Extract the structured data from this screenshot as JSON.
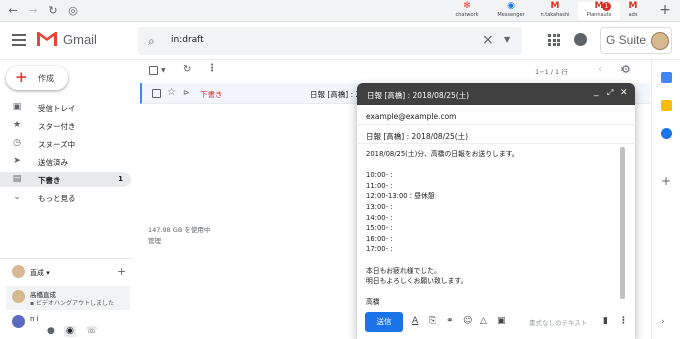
{
  "browser": {
    "extensions": [
      {
        "icon": "✻",
        "label": "chatwork",
        "color": "#e2473a"
      },
      {
        "icon": "◉",
        "label": "Messenger",
        "color": "#1877f2"
      },
      {
        "icon": "M",
        "label": "n.takahashi",
        "color": "#d93025"
      },
      {
        "icon": "M",
        "label": "Plannauts",
        "color": "#d93025",
        "badge": "1"
      },
      {
        "icon": "M",
        "label": "ads",
        "color": "#d93025"
      }
    ]
  },
  "header": {
    "app_name": "Gmail",
    "search_value": "in:draft",
    "gsuite_label": "G Suite"
  },
  "sidebar": {
    "compose_label": "作成",
    "items": [
      {
        "label": "受信トレイ",
        "icon": "▣",
        "count": ""
      },
      {
        "label": "スター付き",
        "icon": "★",
        "count": ""
      },
      {
        "label": "スヌーズ中",
        "icon": "◷",
        "count": ""
      },
      {
        "label": "送信済み",
        "icon": "➤",
        "count": ""
      },
      {
        "label": "下書き",
        "icon": "▤",
        "count": "1",
        "active": true
      },
      {
        "label": "もっと見る",
        "icon": "⌄",
        "count": ""
      }
    ]
  },
  "hangouts": {
    "me": "直成 ▾",
    "contact_name": "高橋直成",
    "contact_status": "ビデオハングアウトしました",
    "other": "n i"
  },
  "toolbar": {
    "range": "1−1 / 1 行"
  },
  "list": {
    "row": {
      "draft_label": "下書き",
      "subject": "日報 [高橋] : 2018/08/25(土)"
    },
    "storage": "147.98 GB を使用中",
    "manage": "管理"
  },
  "compose": {
    "title": "日報 [高橋] : 2018/08/25(土)",
    "to": "example@example.com",
    "subject": "日報 [高橋] : 2018/08/25(土)",
    "body_lines": [
      "2018/08/25(土)分、高橋の日報をお送りします。",
      "",
      "10:00- :",
      "11:00- :",
      "12:00-13:00 : 昼休憩",
      "13:00- :",
      "14:00- :",
      "15:00- :",
      "16:00- :",
      "17:00- :",
      "",
      "本日もお疲れ様でした。",
      "明日もよろしくお願い致します。",
      "",
      "高橋"
    ],
    "send_label": "送信",
    "format_hint": "書式なしのテキスト"
  },
  "colors": {
    "accent": "#1a73e8",
    "draft_red": "#d93025",
    "compose_header": "#404040"
  }
}
